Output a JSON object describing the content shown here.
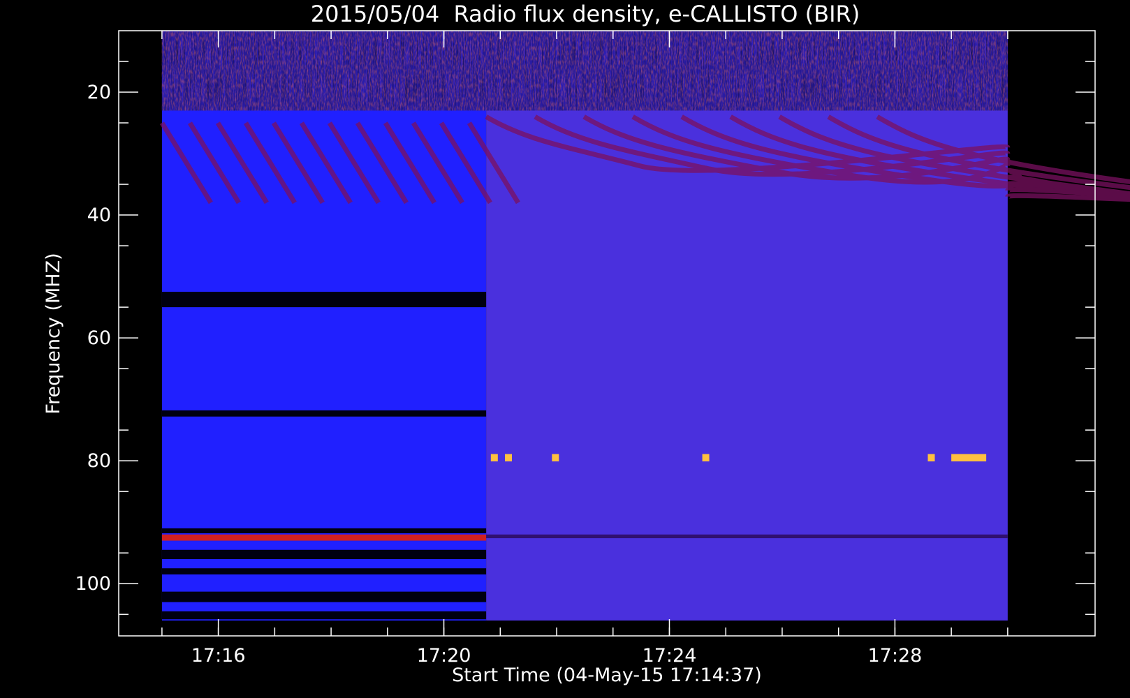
{
  "chart_data": {
    "type": "heatmap",
    "title": "2015/05/04  Radio flux density, e-CALLISTO (BIR)",
    "xlabel": "Start Time (04-May-15 17:14:37)",
    "ylabel": "Frequency (MHZ)",
    "x_start": "17:15:00",
    "x_end": "17:30:00",
    "xlim": [
      "17:14:14",
      "17:31:33"
    ],
    "ylim": [
      108.5,
      10
    ],
    "y_axis_inverted": true,
    "x_ticks": [
      "17:16",
      "17:20",
      "17:24",
      "17:28"
    ],
    "y_ticks": [
      20,
      40,
      60,
      80,
      100
    ],
    "freq_range_mhz": [
      10,
      106
    ],
    "colormap": {
      "low": "#000000",
      "mid": "#2020ff",
      "high": "#d02020",
      "peak": "#ffc040"
    },
    "grid": false,
    "legend": "none",
    "notes": [
      {
        "feature": "band-switch",
        "time": "17:20:45"
      },
      {
        "feature": "interference",
        "time_range": [
          "17:15:00",
          "17:20:45"
        ],
        "freq_mhz": [
          53,
          55
        ]
      },
      {
        "feature": "interference",
        "time_range": [
          "17:15:00",
          "17:20:45"
        ],
        "freq_mhz": [
          92,
          93
        ]
      },
      {
        "feature": "burst-dots",
        "freq_mhz": 79.5,
        "times": [
          "17:20:50",
          "17:21:05",
          "17:21:55",
          "17:24:35",
          "17:28:35",
          "17:29:00"
        ]
      }
    ]
  }
}
